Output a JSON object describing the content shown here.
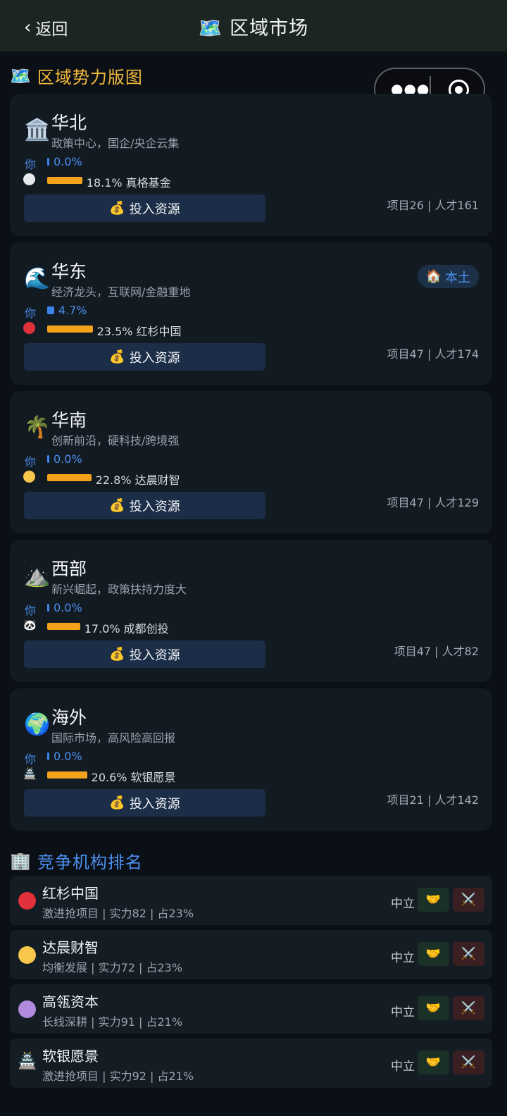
{
  "header": {
    "back_label": "返回",
    "title": "区域市场",
    "title_icon": "🗺️"
  },
  "section_map": {
    "icon": "🗺️",
    "title": "区域势力版图"
  },
  "regions": [
    {
      "icon": "🏛️",
      "name": "华北",
      "desc": "政策中心，国企/央企云集",
      "you_label": "你",
      "you_share": 0.0,
      "you_pct": "0.0%",
      "leader_icon": "⚪",
      "leader_color": "#e6e9ee",
      "leader_share": 18.1,
      "leader_text": "18.1% 真格基金",
      "invest_label": "投入资源",
      "stats": "项目26 | 人才161"
    },
    {
      "icon": "🌊",
      "name": "华东",
      "desc": "经济龙头，互联网/金融重地",
      "you_label": "你",
      "you_share": 4.7,
      "you_pct": "4.7%",
      "leader_icon": "●",
      "leader_color": "#e0313d",
      "leader_share": 23.5,
      "leader_text": "23.5% 红杉中国",
      "invest_label": "投入资源",
      "stats": "项目47 | 人才174",
      "badge": "本土",
      "badge_icon": "🏠"
    },
    {
      "icon": "🌴",
      "name": "华南",
      "desc": "创新前沿，硬科技/跨境强",
      "you_label": "你",
      "you_share": 0.0,
      "you_pct": "0.0%",
      "leader_icon": "●",
      "leader_color": "#f7c64a",
      "leader_share": 22.8,
      "leader_text": "22.8% 达晨财智",
      "invest_label": "投入资源",
      "stats": "项目47 | 人才129"
    },
    {
      "icon": "⛰️",
      "name": "西部",
      "desc": "新兴崛起，政策扶持力度大",
      "you_label": "你",
      "you_share": 0.0,
      "you_pct": "0.0%",
      "leader_icon": "🐼",
      "leader_color": "#ffffff",
      "leader_share": 17.0,
      "leader_text": "17.0% 成都创投",
      "invest_label": "投入资源",
      "stats": "项目47 | 人才82"
    },
    {
      "icon": "🌍",
      "name": "海外",
      "desc": "国际市场，高风险高回报",
      "you_label": "你",
      "you_share": 0.0,
      "you_pct": "0.0%",
      "leader_icon": "🏯",
      "leader_color": "#cccccc",
      "leader_share": 20.6,
      "leader_text": "20.6% 软银愿景",
      "invest_label": "投入资源",
      "stats": "项目21 | 人才142"
    }
  ],
  "invest_icon": "💰",
  "section_rank": {
    "icon": "🏢",
    "title": "竞争机构排名"
  },
  "rankings": [
    {
      "name": "红杉中国",
      "info": "激进抢项目 | 实力82 | 占23%",
      "color": "#e0313d",
      "status": "中立"
    },
    {
      "name": "达晨财智",
      "info": "均衡发展 | 实力72 | 占23%",
      "color": "#f7c64a",
      "status": "中立"
    },
    {
      "name": "高瓴资本",
      "info": "长线深耕 | 实力91 | 占21%",
      "color": "#b18be0",
      "status": "中立"
    },
    {
      "name": "软银愿景",
      "info": "激进抢项目 | 实力92 | 占21%",
      "emoji": "🏯",
      "status": "中立"
    }
  ],
  "actions": {
    "ally_icon": "🤝",
    "fight_icon": "⚔️"
  }
}
